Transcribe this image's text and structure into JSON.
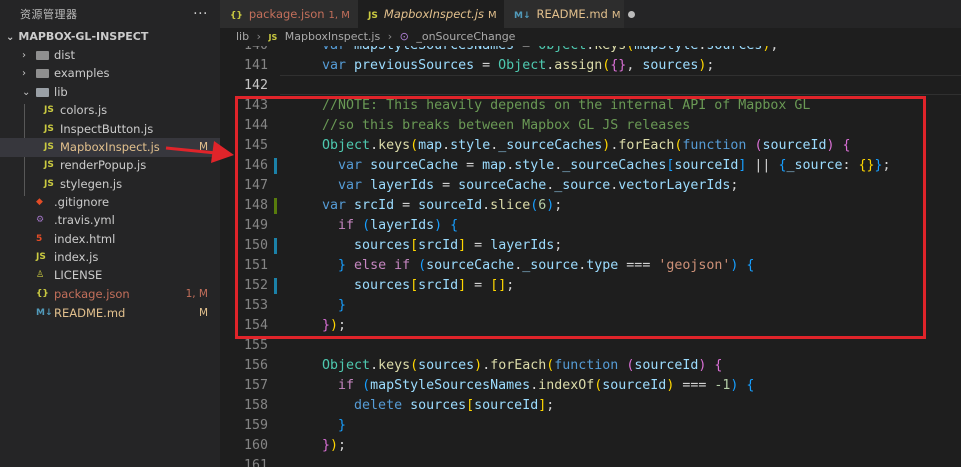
{
  "explorer": {
    "title": "资源管理器",
    "more": "···",
    "project": "MAPBOX-GL-INSPECT",
    "items": [
      {
        "name": "dist",
        "kind": "folder",
        "chevron": "›"
      },
      {
        "name": "examples",
        "kind": "folder",
        "chevron": "›"
      },
      {
        "name": "lib",
        "kind": "folder-open",
        "chevron": "⌄"
      },
      {
        "name": "colors.js",
        "icon": "JS"
      },
      {
        "name": "InspectButton.js",
        "icon": "JS"
      },
      {
        "name": "MapboxInspect.js",
        "icon": "JS",
        "status": "M",
        "statusColor": "#e2c08d"
      },
      {
        "name": "renderPopup.js",
        "icon": "JS"
      },
      {
        "name": "stylegen.js",
        "icon": "JS"
      },
      {
        "name": ".gitignore",
        "icon": "◆"
      },
      {
        "name": ".travis.yml",
        "icon": "⚙"
      },
      {
        "name": "index.html",
        "icon": "5"
      },
      {
        "name": "index.js",
        "icon": "JS"
      },
      {
        "name": "LICENSE",
        "icon": "♙"
      },
      {
        "name": "package.json",
        "icon": "{}",
        "status": "1, M",
        "statusColor": "#c36f5b"
      },
      {
        "name": "README.md",
        "icon": "M↓",
        "status": "M",
        "statusColor": "#e2c08d"
      }
    ]
  },
  "tabs": [
    {
      "label": "package.json",
      "icon": "{}",
      "mod": "1, M",
      "close": "×"
    },
    {
      "label": "MapboxInspect.js",
      "icon": "JS",
      "mod": "M",
      "close": "×"
    },
    {
      "label": "README.md",
      "icon": "M↓",
      "mod": "M"
    }
  ],
  "breadcrumb": {
    "folder": "lib",
    "sep": "›",
    "file": "MapboxInspect.js",
    "file_icon": "JS",
    "symbol_icon": "⊙",
    "symbol": "_onSourceChange"
  },
  "code": {
    "line_numbers": [
      "140",
      "141",
      "142",
      "143",
      "144",
      "145",
      "146",
      "147",
      "148",
      "149",
      "150",
      "151",
      "152",
      "153",
      "154",
      "155",
      "156",
      "157",
      "158",
      "159",
      "160",
      "161"
    ],
    "lines": [
      [
        [
          "kw",
          "    var "
        ],
        [
          "var",
          "mapStyleSourcesNames"
        ],
        [
          "pl",
          " = "
        ],
        [
          "cls",
          "Object"
        ],
        [
          "pl",
          "."
        ],
        [
          "fn",
          "keys"
        ],
        [
          "b1",
          "("
        ],
        [
          "var",
          "mapStyle"
        ],
        [
          "pl",
          "."
        ],
        [
          "var",
          "sources"
        ],
        [
          "b1",
          ")"
        ],
        [
          "pl",
          ";"
        ]
      ],
      [
        [
          "kw",
          "    var "
        ],
        [
          "var",
          "previousSources"
        ],
        [
          "pl",
          " = "
        ],
        [
          "cls",
          "Object"
        ],
        [
          "pl",
          "."
        ],
        [
          "fn",
          "assign"
        ],
        [
          "b1",
          "("
        ],
        [
          "b2",
          "{}"
        ],
        [
          "pl",
          ", "
        ],
        [
          "var",
          "sources"
        ],
        [
          "b1",
          ")"
        ],
        [
          "pl",
          ";"
        ]
      ],
      [
        [
          "pl",
          ""
        ]
      ],
      [
        [
          "cmt",
          "    //NOTE: This heavily depends on the internal API of Mapbox GL"
        ]
      ],
      [
        [
          "cmt",
          "    //so this breaks between Mapbox GL JS releases"
        ]
      ],
      [
        [
          "cls",
          "    Object"
        ],
        [
          "pl",
          "."
        ],
        [
          "fn",
          "keys"
        ],
        [
          "b1",
          "("
        ],
        [
          "var",
          "map"
        ],
        [
          "pl",
          "."
        ],
        [
          "var",
          "style"
        ],
        [
          "pl",
          "."
        ],
        [
          "var",
          "_sourceCaches"
        ],
        [
          "b1",
          ")"
        ],
        [
          "pl",
          "."
        ],
        [
          "fn",
          "forEach"
        ],
        [
          "b1",
          "("
        ],
        [
          "kw",
          "function "
        ],
        [
          "b2",
          "("
        ],
        [
          "var",
          "sourceId"
        ],
        [
          "b2",
          ")"
        ],
        [
          "pl",
          " "
        ],
        [
          "b2",
          "{"
        ]
      ],
      [
        [
          "kw",
          "      var "
        ],
        [
          "var",
          "sourceCache"
        ],
        [
          "pl",
          " = "
        ],
        [
          "var",
          "map"
        ],
        [
          "pl",
          "."
        ],
        [
          "var",
          "style"
        ],
        [
          "pl",
          "."
        ],
        [
          "var",
          "_sourceCaches"
        ],
        [
          "b3",
          "["
        ],
        [
          "var",
          "sourceId"
        ],
        [
          "b3",
          "]"
        ],
        [
          "pl",
          " || "
        ],
        [
          "b3",
          "{"
        ],
        [
          "var",
          "_source"
        ],
        [
          "pl",
          ": "
        ],
        [
          "b1",
          "{}"
        ],
        [
          "b3",
          "}"
        ],
        [
          "pl",
          ";"
        ]
      ],
      [
        [
          "kw",
          "      var "
        ],
        [
          "var",
          "layerIds"
        ],
        [
          "pl",
          " = "
        ],
        [
          "var",
          "sourceCache"
        ],
        [
          "pl",
          "."
        ],
        [
          "var",
          "_source"
        ],
        [
          "pl",
          "."
        ],
        [
          "var",
          "vectorLayerIds"
        ],
        [
          "pl",
          ";"
        ]
      ],
      [
        [
          "kw",
          "    var "
        ],
        [
          "var",
          "srcId"
        ],
        [
          "pl",
          " = "
        ],
        [
          "var",
          "sourceId"
        ],
        [
          "pl",
          "."
        ],
        [
          "fn",
          "slice"
        ],
        [
          "b3",
          "("
        ],
        [
          "num",
          "6"
        ],
        [
          "b3",
          ")"
        ],
        [
          "pl",
          ";"
        ]
      ],
      [
        [
          "ctl",
          "      if "
        ],
        [
          "b3",
          "("
        ],
        [
          "var",
          "layerIds"
        ],
        [
          "b3",
          ")"
        ],
        [
          "pl",
          " "
        ],
        [
          "b3",
          "{"
        ]
      ],
      [
        [
          "var",
          "        sources"
        ],
        [
          "b1",
          "["
        ],
        [
          "var",
          "srcId"
        ],
        [
          "b1",
          "]"
        ],
        [
          "pl",
          " = "
        ],
        [
          "var",
          "layerIds"
        ],
        [
          "pl",
          ";"
        ]
      ],
      [
        [
          "b3",
          "      }"
        ],
        [
          "ctl",
          " else if "
        ],
        [
          "b3",
          "("
        ],
        [
          "var",
          "sourceCache"
        ],
        [
          "pl",
          "."
        ],
        [
          "var",
          "_source"
        ],
        [
          "pl",
          "."
        ],
        [
          "var",
          "type"
        ],
        [
          "pl",
          " === "
        ],
        [
          "str",
          "'geojson'"
        ],
        [
          "b3",
          ")"
        ],
        [
          "pl",
          " "
        ],
        [
          "b3",
          "{"
        ]
      ],
      [
        [
          "var",
          "        sources"
        ],
        [
          "b1",
          "["
        ],
        [
          "var",
          "srcId"
        ],
        [
          "b1",
          "]"
        ],
        [
          "pl",
          " = "
        ],
        [
          "b1",
          "[]"
        ],
        [
          "pl",
          ";"
        ]
      ],
      [
        [
          "b3",
          "      }"
        ]
      ],
      [
        [
          "b2",
          "    }"
        ],
        [
          "b1",
          ")"
        ],
        [
          "pl",
          ";"
        ]
      ],
      [
        [
          "pl",
          ""
        ]
      ],
      [
        [
          "cls",
          "    Object"
        ],
        [
          "pl",
          "."
        ],
        [
          "fn",
          "keys"
        ],
        [
          "b1",
          "("
        ],
        [
          "var",
          "sources"
        ],
        [
          "b1",
          ")"
        ],
        [
          "pl",
          "."
        ],
        [
          "fn",
          "forEach"
        ],
        [
          "b1",
          "("
        ],
        [
          "kw",
          "function "
        ],
        [
          "b2",
          "("
        ],
        [
          "var",
          "sourceId"
        ],
        [
          "b2",
          ")"
        ],
        [
          "pl",
          " "
        ],
        [
          "b2",
          "{"
        ]
      ],
      [
        [
          "ctl",
          "      if "
        ],
        [
          "b3",
          "("
        ],
        [
          "var",
          "mapStyleSourcesNames"
        ],
        [
          "pl",
          "."
        ],
        [
          "fn",
          "indexOf"
        ],
        [
          "b1",
          "("
        ],
        [
          "var",
          "sourceId"
        ],
        [
          "b1",
          ")"
        ],
        [
          "pl",
          " === "
        ],
        [
          "num",
          "-1"
        ],
        [
          "b3",
          ")"
        ],
        [
          "pl",
          " "
        ],
        [
          "b3",
          "{"
        ]
      ],
      [
        [
          "kw",
          "        delete "
        ],
        [
          "var",
          "sources"
        ],
        [
          "b1",
          "["
        ],
        [
          "var",
          "sourceId"
        ],
        [
          "b1",
          "]"
        ],
        [
          "pl",
          ";"
        ]
      ],
      [
        [
          "b3",
          "      }"
        ]
      ],
      [
        [
          "b2",
          "    }"
        ],
        [
          "b1",
          ")"
        ],
        [
          "pl",
          ";"
        ]
      ],
      [
        [
          "pl",
          ""
        ]
      ]
    ]
  },
  "colors": {
    "highlight": "#e0242a",
    "background": "#1e1e1e",
    "sidebar": "#252526"
  }
}
